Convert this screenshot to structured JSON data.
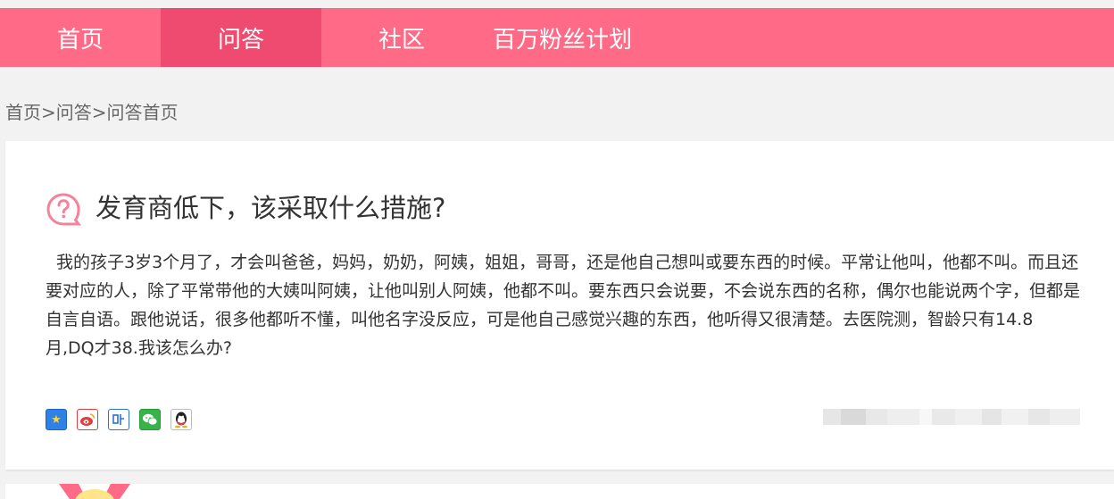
{
  "nav": {
    "items": [
      {
        "label": "首页",
        "active": false
      },
      {
        "label": "问答",
        "active": true
      },
      {
        "label": "社区",
        "active": false
      },
      {
        "label": "百万粉丝计划",
        "active": false
      }
    ]
  },
  "breadcrumb": {
    "home": "首页",
    "sep1": ">",
    "qa": "问答",
    "sep2": ">",
    "current": "问答首页"
  },
  "question": {
    "title": "发育商低下，该采取什么措施?",
    "body": "我的孩子3岁3个月了，才会叫爸爸，妈妈，奶奶，阿姨，姐姐，哥哥，还是他自己想叫或要东西的时候。平常让他叫，他都不叫。而且还要对应的人，除了平常带他的大姨叫阿姨，让他叫别人阿姨，他都不叫。要东西只会说要，不会说东西的名称，偶尔也能说两个字，但都是自言自语。跟他说话，很多他都听不懂，叫他名字没反应，可是他自己感觉兴趣的东西，他听得又很清楚。去医院测，智龄只有14.8月,DQ才38.我该怎么办?"
  },
  "share": {
    "icons": [
      {
        "name": "qzone-share-icon"
      },
      {
        "name": "weibo-share-icon"
      },
      {
        "name": "tieba-share-icon"
      },
      {
        "name": "wechat-share-icon"
      },
      {
        "name": "qq-share-icon"
      }
    ]
  },
  "colors": {
    "nav_bg": "#ff6b86",
    "nav_active": "#ef4a70",
    "page_bg": "#f2f2f2"
  }
}
